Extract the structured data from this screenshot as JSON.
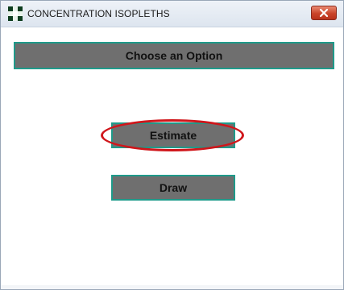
{
  "window": {
    "title": "CONCENTRATION ISOPLETHS",
    "icon": "checkered-app-icon",
    "close_icon": "close-x-icon"
  },
  "content": {
    "header_label": "Choose an Option",
    "buttons": [
      {
        "label": "Estimate",
        "highlighted": true
      },
      {
        "label": "Draw",
        "highlighted": false
      }
    ]
  },
  "colors": {
    "button_fill": "#6f6f6f",
    "button_border": "#1f9a8a",
    "highlight": "#d0161b",
    "close_button": "#c9432a"
  }
}
